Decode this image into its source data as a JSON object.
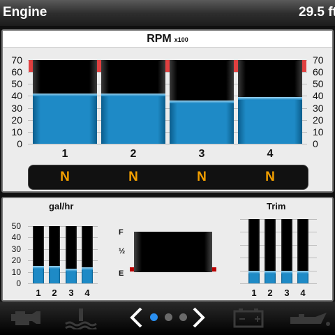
{
  "header": {
    "title": "Engine",
    "value": "29.5 ft"
  },
  "rpm_panel": {
    "title": "RPM",
    "unit": "x100",
    "ticks": [
      "70",
      "60",
      "50",
      "40",
      "30",
      "20",
      "10",
      "0"
    ],
    "engines": [
      "1",
      "2",
      "3",
      "4"
    ],
    "gears": [
      "N",
      "N",
      "N",
      "N"
    ]
  },
  "fuel_rate": {
    "title": "gal/hr",
    "ticks": [
      "50",
      "40",
      "30",
      "20",
      "10",
      "0"
    ],
    "engines": [
      "1",
      "2",
      "3",
      "4"
    ]
  },
  "tank": {
    "full": "F",
    "half": "½",
    "empty": "E",
    "level": 1.0
  },
  "trim": {
    "title": "Trim",
    "engines": [
      "1",
      "2",
      "3",
      "4"
    ],
    "levels": [
      0.2,
      0.2,
      0.2,
      0.2
    ]
  },
  "nav": {
    "icons": [
      "engine-icon",
      "coolant-temp-icon",
      "battery-icon",
      "oil-pressure-icon"
    ],
    "page_dots": 3,
    "active_dot": 0
  },
  "chart_data": [
    {
      "type": "bar",
      "title": "RPM",
      "ylabel": "x100",
      "categories": [
        "1",
        "2",
        "3",
        "4"
      ],
      "values": [
        42,
        42,
        36,
        39
      ],
      "ylim": [
        0,
        70
      ],
      "redline_from": 60
    },
    {
      "type": "bar",
      "title": "gal/hr",
      "categories": [
        "1",
        "2",
        "3",
        "4"
      ],
      "values": [
        15,
        15,
        13,
        14
      ],
      "ylim": [
        0,
        50
      ]
    }
  ],
  "colors": {
    "bar_fill": "#1e8ac6",
    "gear_text": "#f4a000",
    "redline": "#e04040",
    "active_dot": "#2a8ff0"
  }
}
